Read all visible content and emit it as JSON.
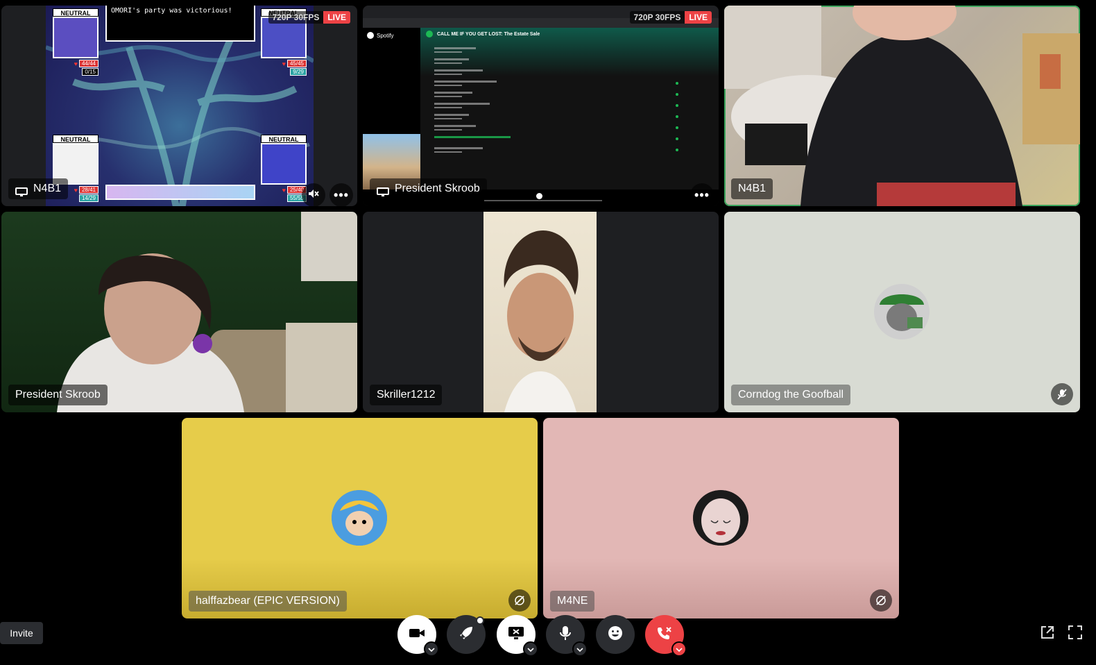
{
  "tiles": {
    "t1": {
      "name": "N4B1",
      "quality": "720P 30FPS",
      "live": "LIVE"
    },
    "t2": {
      "name": "President Skroob",
      "quality": "720P 30FPS",
      "live": "LIVE"
    },
    "t3": {
      "name": "N4B1"
    },
    "t4": {
      "name": "President Skroob"
    },
    "t5": {
      "name": "Skriller1212"
    },
    "t6": {
      "name": "Corndog the Goofball"
    },
    "t7": {
      "name": "halffazbear (EPIC VERSION)"
    },
    "t8": {
      "name": "M4NE"
    }
  },
  "game": {
    "message": "OMORI's party was victorious!",
    "status_tl": "NEUTRAL",
    "status_tr": "NEUTRAL",
    "status_bl": "NEUTRAL",
    "status_br": "NEUTRAL",
    "hp_tl": "44/44",
    "mp_tl": "0/15",
    "hp_tr": "45/45",
    "mp_tr": "9/29",
    "hp_bl": "28/41",
    "mp_bl": "14/29",
    "hp_br": "25/40",
    "mp_br": "55/55"
  },
  "spotify": {
    "brand": "Spotify",
    "playlist_title": "CALL ME IF YOU GET LOST: The Estate Sale"
  },
  "controls": {
    "invite_label": "Invite"
  },
  "colors": {
    "speaking_outline": "#3ba55c",
    "live_badge": "#ed4245",
    "end_call": "#ed4245",
    "tile_yellow": "#e6cc4a",
    "tile_pink": "#e2b7b5",
    "tile_gray": "#d8dbd3"
  }
}
